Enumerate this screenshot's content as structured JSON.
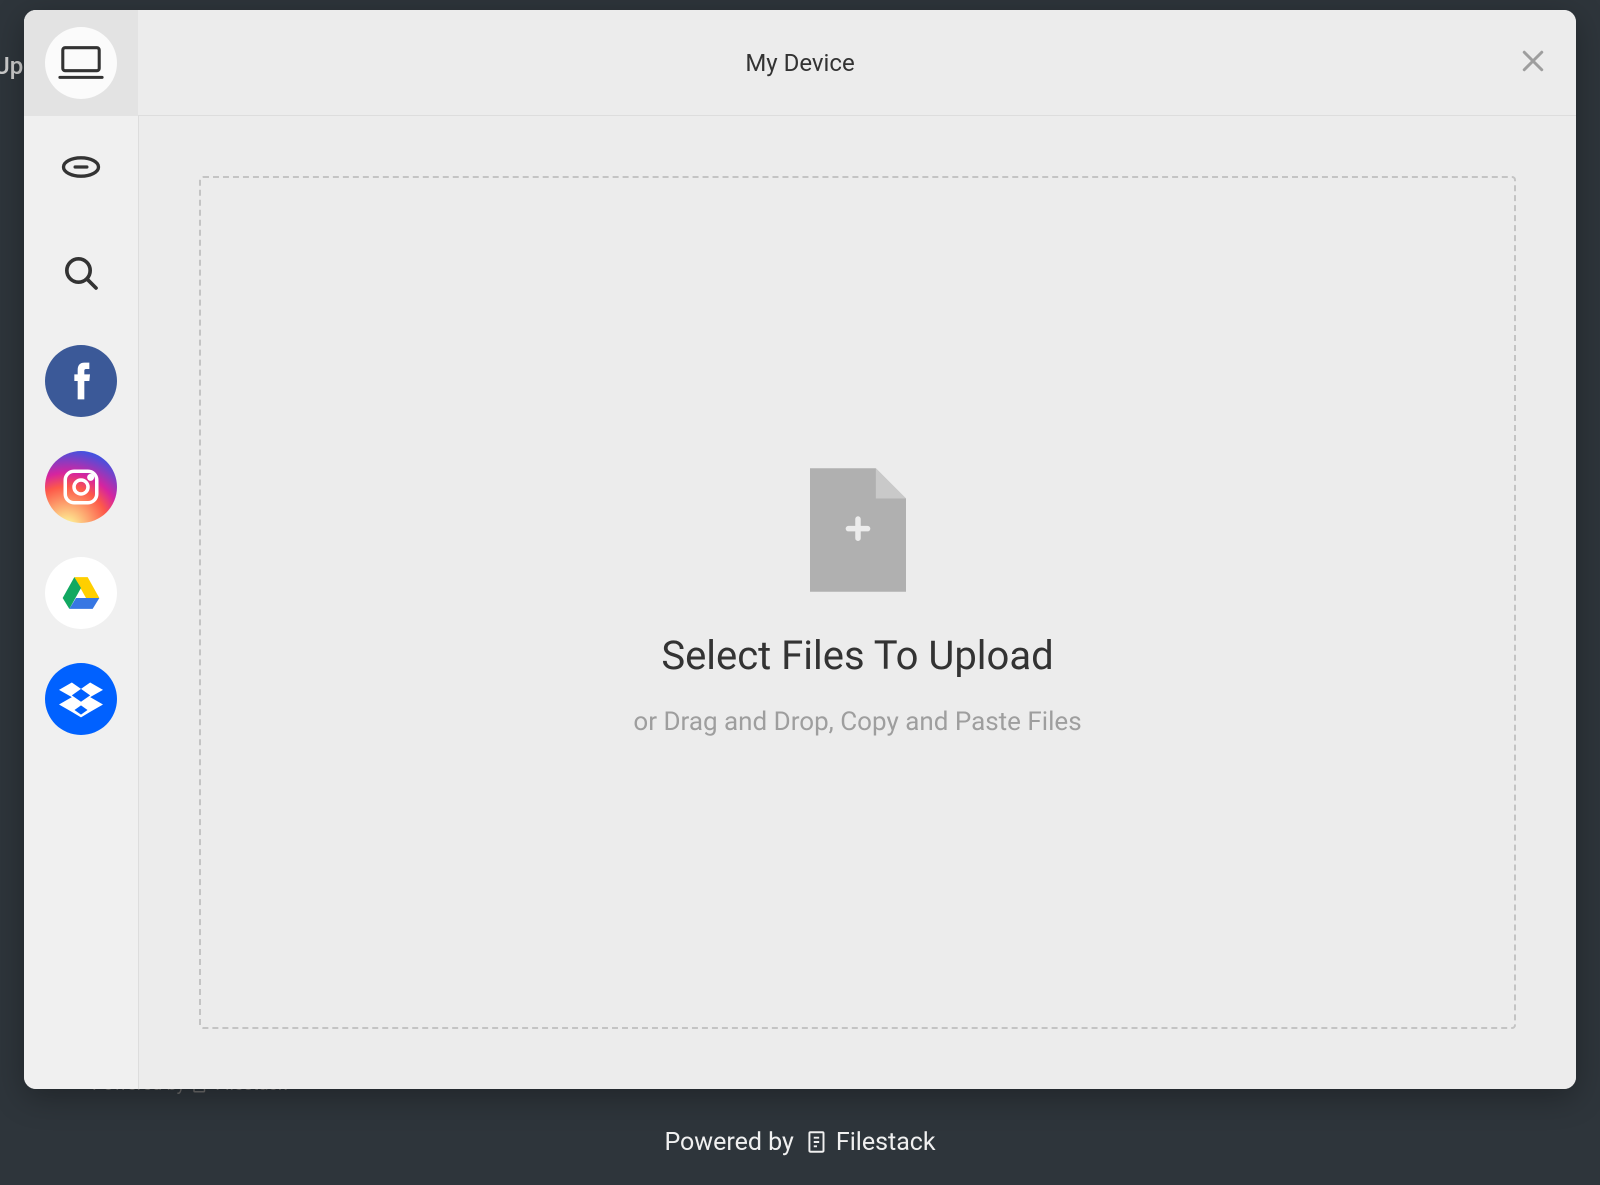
{
  "header": {
    "title": "My Device"
  },
  "sidebar": {
    "items": [
      {
        "name": "my-device",
        "icon": "monitor-icon"
      },
      {
        "name": "link-url",
        "icon": "link-icon"
      },
      {
        "name": "web-search",
        "icon": "search-icon"
      },
      {
        "name": "facebook",
        "icon": "facebook-icon"
      },
      {
        "name": "instagram",
        "icon": "instagram-icon"
      },
      {
        "name": "google-drive",
        "icon": "google-drive-icon"
      },
      {
        "name": "dropbox",
        "icon": "dropbox-icon"
      }
    ]
  },
  "dropzone": {
    "title": "Select Files To Upload",
    "subtitle": "or Drag and Drop, Copy and Paste Files"
  },
  "footer": {
    "powered_by": "Powered by",
    "brand": "Filestack"
  }
}
